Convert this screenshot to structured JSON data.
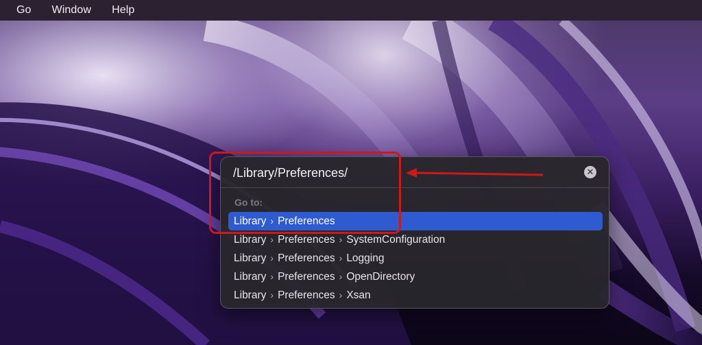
{
  "menubar": {
    "items": [
      "Go",
      "Window",
      "Help"
    ]
  },
  "goto_panel": {
    "path_value": "/Library/Preferences/",
    "clear_icon": "xmark-circle-icon",
    "section_label": "Go to:",
    "separator": "›",
    "results": [
      {
        "parts": [
          "Library",
          "Preferences"
        ],
        "selected": true
      },
      {
        "parts": [
          "Library",
          "Preferences",
          "SystemConfiguration"
        ],
        "selected": false
      },
      {
        "parts": [
          "Library",
          "Preferences",
          "Logging"
        ],
        "selected": false
      },
      {
        "parts": [
          "Library",
          "Preferences",
          "OpenDirectory"
        ],
        "selected": false
      },
      {
        "parts": [
          "Library",
          "Preferences",
          "Xsan"
        ],
        "selected": false
      }
    ]
  },
  "colors": {
    "selection": "#2f5bd0",
    "annotation": "#d01818",
    "panel_bg": "#28262c"
  }
}
